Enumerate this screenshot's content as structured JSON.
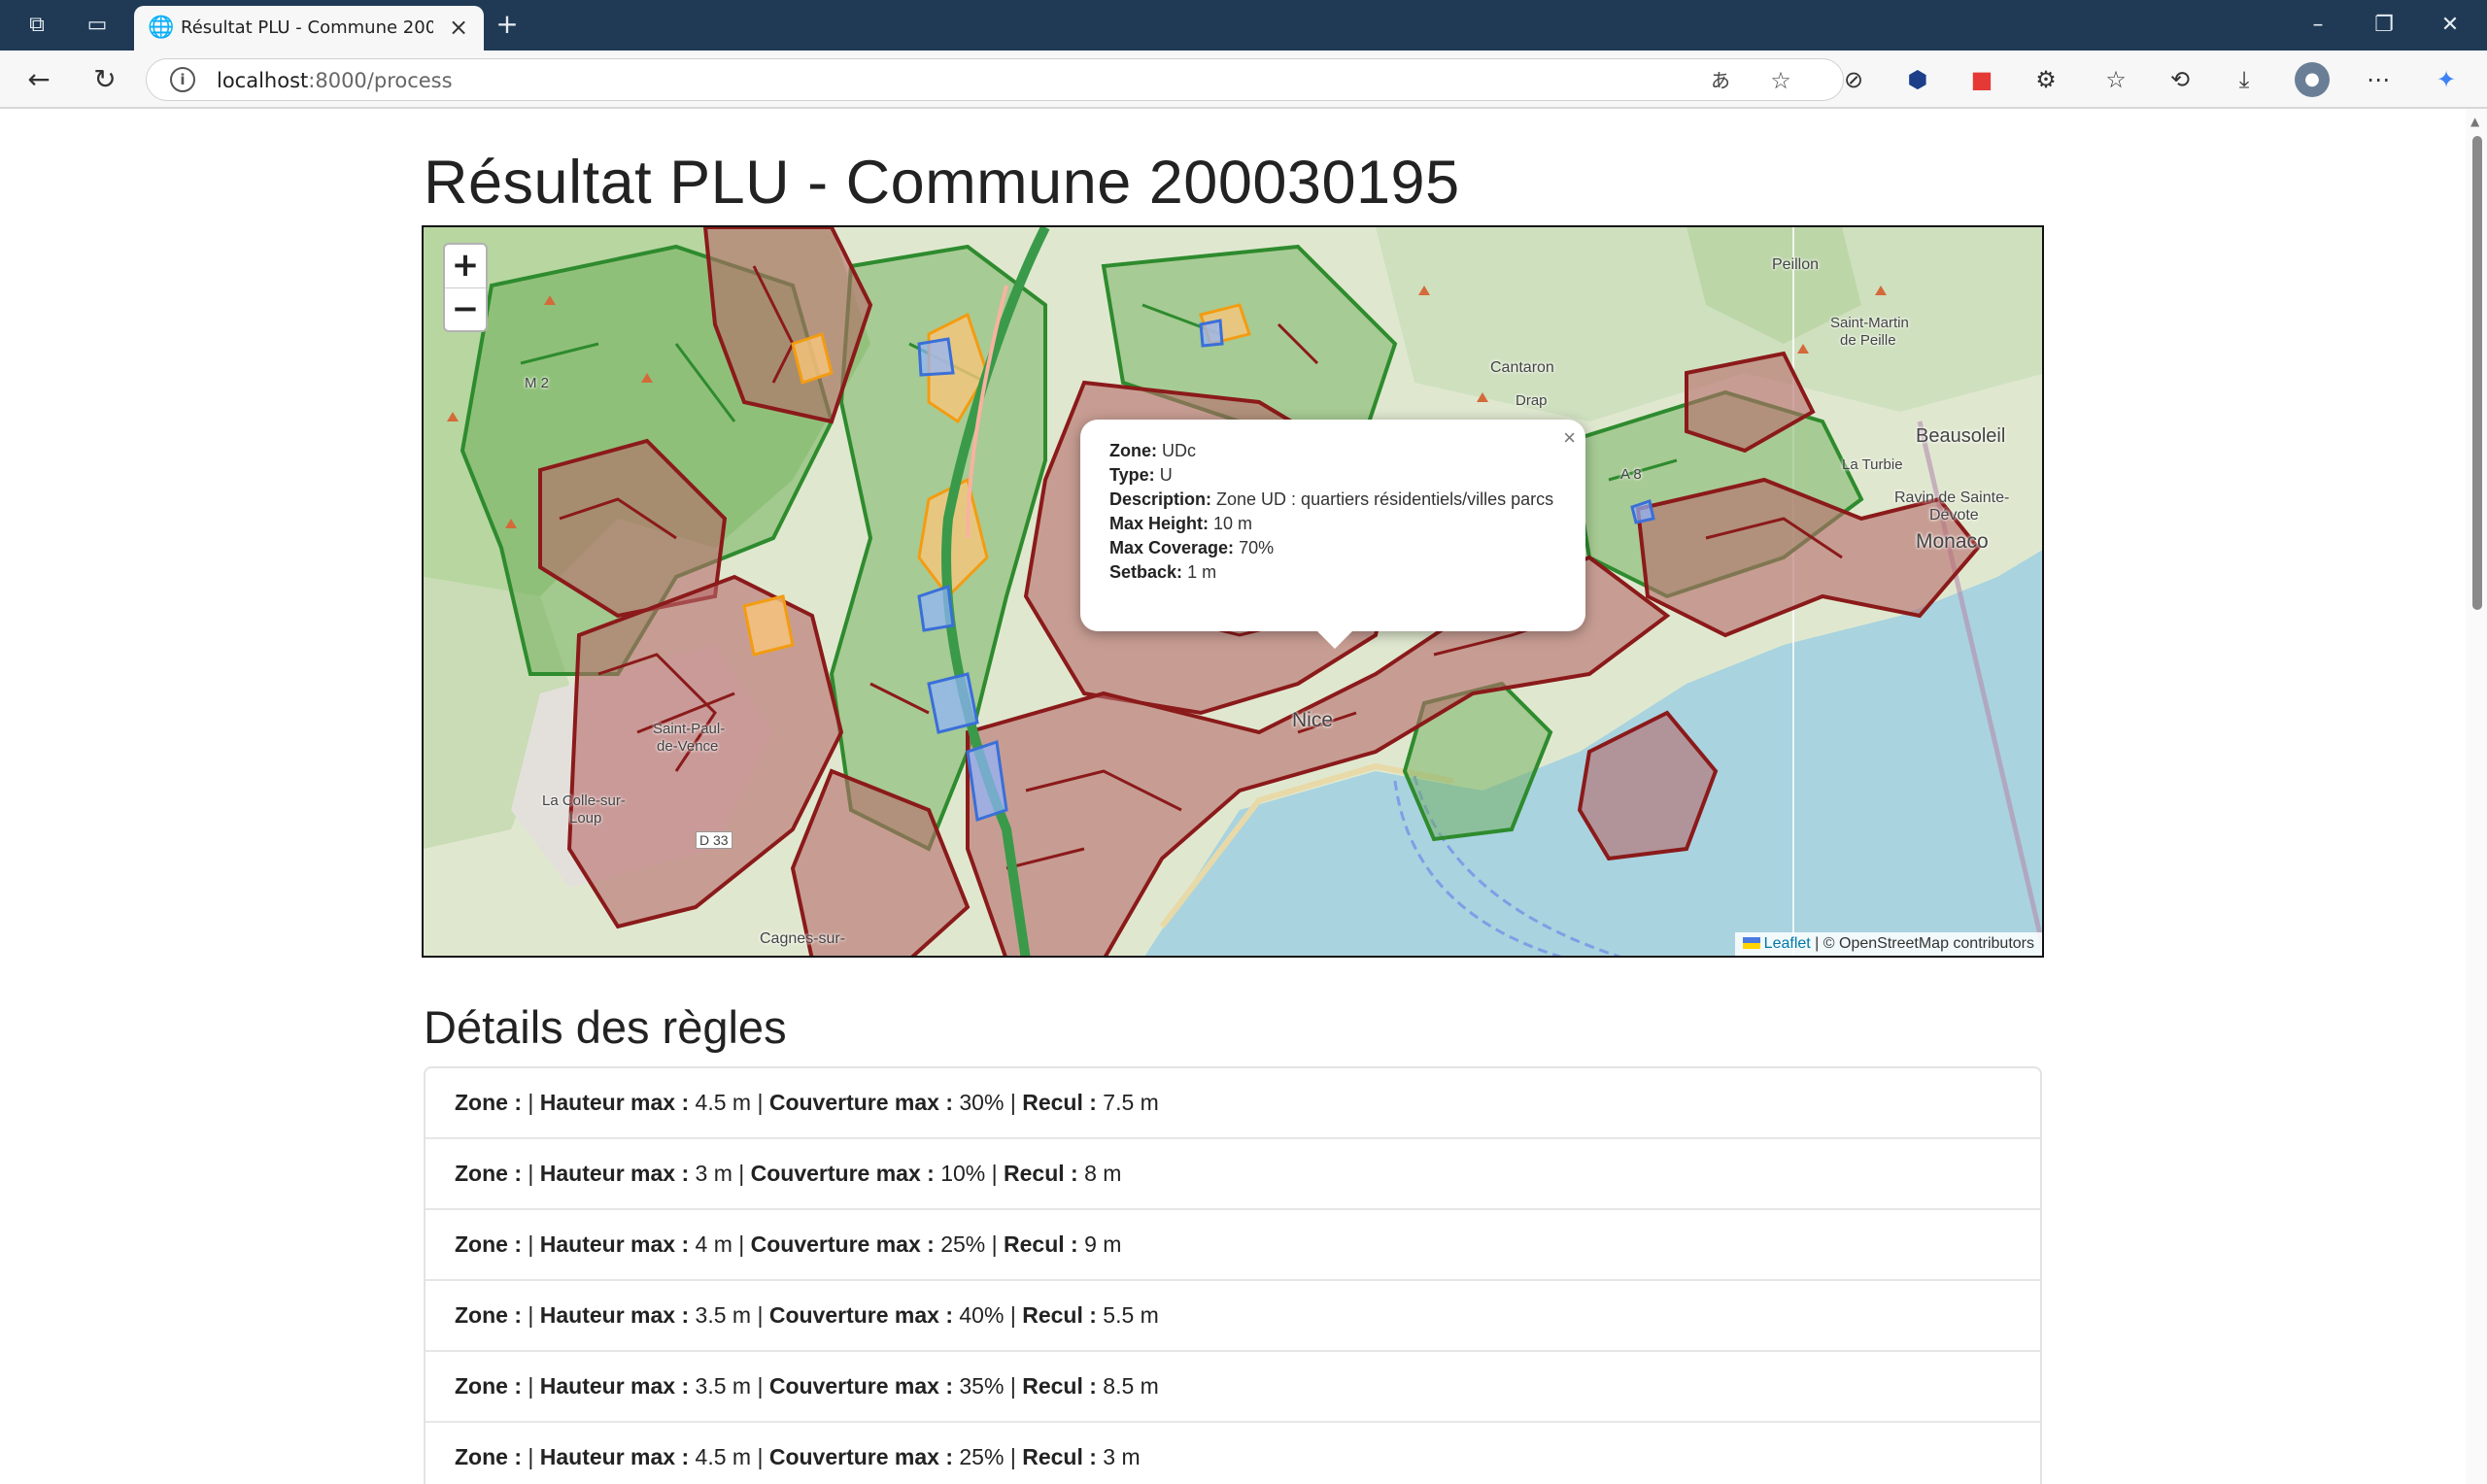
{
  "browser": {
    "tab_title": "Résultat PLU - Commune 200030195",
    "url_host": "localhost",
    "url_path": ":8000/process"
  },
  "page": {
    "title": "Résultat PLU - Commune 200030195",
    "section_title": "Détails des règles"
  },
  "map": {
    "zoom_in": "+",
    "zoom_out": "−",
    "labels": {
      "peillon": "Peillon",
      "saint_martin": "Saint-Martin",
      "de_peille": "de Peille",
      "cantaron": "Cantaron",
      "drap": "Drap",
      "m2": "M 2",
      "a8": "A 8",
      "beausoleil": "Beausoleil",
      "la_turbie": "La Turbie",
      "ravin": "Ravin de Sainte-",
      "devote": "Dévote",
      "monaco": "Monaco",
      "nice": "Nice",
      "saint_paul": "Saint-Paul-",
      "de_vence": "de-Vence",
      "la_colle": "La Colle-sur-",
      "loup": "Loup",
      "d33": "D 33",
      "cagnes": "Cagnes-sur-"
    },
    "popup": {
      "close": "×",
      "zone_label": "Zone:",
      "zone_value": "UDc",
      "type_label": "Type:",
      "type_value": "U",
      "desc_label": "Description:",
      "desc_value": "Zone UD : quartiers résidentiels/villes parcs",
      "height_label": "Max Height:",
      "height_value": "10 m",
      "coverage_label": "Max Coverage:",
      "coverage_value": "70%",
      "setback_label": "Setback:",
      "setback_value": "1 m"
    },
    "attribution": {
      "leaflet": "Leaflet",
      "osm": "| © OpenStreetMap contributors"
    }
  },
  "labels": {
    "zone": "Zone :",
    "hauteur": "Hauteur max :",
    "couverture": "Couverture max :",
    "recul": "Recul :",
    "sep": "|"
  },
  "rules": [
    {
      "hauteur": "4.5 m",
      "couverture": "30%",
      "recul": "7.5 m"
    },
    {
      "hauteur": "3 m",
      "couverture": "10%",
      "recul": "8 m"
    },
    {
      "hauteur": "4 m",
      "couverture": "25%",
      "recul": "9 m"
    },
    {
      "hauteur": "3.5 m",
      "couverture": "40%",
      "recul": "5.5 m"
    },
    {
      "hauteur": "3.5 m",
      "couverture": "35%",
      "recul": "8.5 m"
    },
    {
      "hauteur": "4.5 m",
      "couverture": "25%",
      "recul": "3 m"
    }
  ],
  "colors": {
    "zone_u": "#8b1a1a",
    "zone_n": "#2e8b2e",
    "zone_au": "#f39c12",
    "zone_a": "#3a6fd8",
    "sea": "#a9d3df"
  }
}
